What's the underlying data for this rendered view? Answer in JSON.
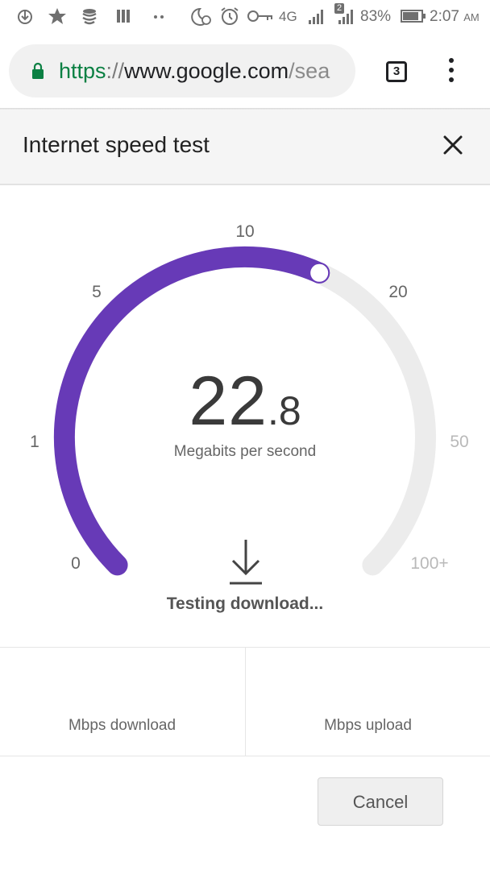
{
  "status_bar": {
    "battery_percent": "83%",
    "time": "2:07",
    "time_suffix": "AM",
    "network": "4G",
    "sim2_badge": "2"
  },
  "browser": {
    "url_scheme": "https",
    "url_separator": "://",
    "url_host": "www.google.com",
    "url_path": "/sea",
    "tab_count": "3",
    "lock_color": "#0b8043"
  },
  "card": {
    "title": "Internet speed test",
    "close_icon": "close-icon"
  },
  "gauge": {
    "ticks": [
      "0",
      "1",
      "5",
      "10",
      "20",
      "50",
      "100+"
    ],
    "speed_integer": "22",
    "speed_decimal": ".8",
    "unit": "Megabits per second",
    "progress_fraction": 0.59,
    "accent_color": "#673ab7",
    "track_color": "#ececec",
    "status": "Testing download..."
  },
  "results": {
    "download_label": "Mbps download",
    "upload_label": "Mbps upload"
  },
  "actions": {
    "cancel_label": "Cancel"
  }
}
